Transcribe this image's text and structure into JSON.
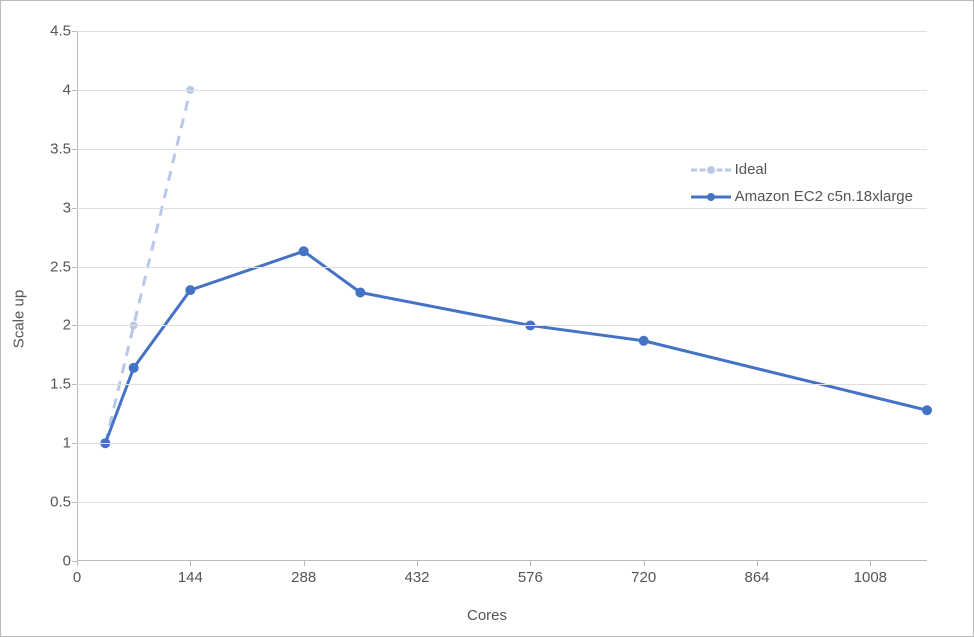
{
  "chart_data": {
    "type": "line",
    "xlabel": "Cores",
    "ylabel": "Scale up",
    "xlim": [
      0,
      1080
    ],
    "ylim": [
      0,
      4.5
    ],
    "x_ticks": [
      0,
      144,
      288,
      432,
      576,
      720,
      864,
      1008
    ],
    "y_ticks": [
      0,
      0.5,
      1,
      1.5,
      2,
      2.5,
      3,
      3.5,
      4,
      4.5
    ],
    "series": [
      {
        "name": "Ideal",
        "style": "dashed",
        "color": "#b9c8e8",
        "x": [
          36,
          72,
          144
        ],
        "y": [
          1,
          2,
          4
        ]
      },
      {
        "name": "Amazon EC2 c5n.18xlarge",
        "style": "solid",
        "color": "#4472c4",
        "x": [
          36,
          72,
          144,
          288,
          360,
          576,
          720,
          1080
        ],
        "y": [
          1.0,
          1.64,
          2.3,
          2.63,
          2.28,
          2.0,
          1.87,
          1.28
        ]
      }
    ]
  },
  "legend": {
    "items": [
      {
        "label": "Ideal"
      },
      {
        "label": "Amazon EC2 c5n.18xlarge"
      }
    ]
  },
  "axes": {
    "x_title": "Cores",
    "y_title": "Scale up"
  }
}
